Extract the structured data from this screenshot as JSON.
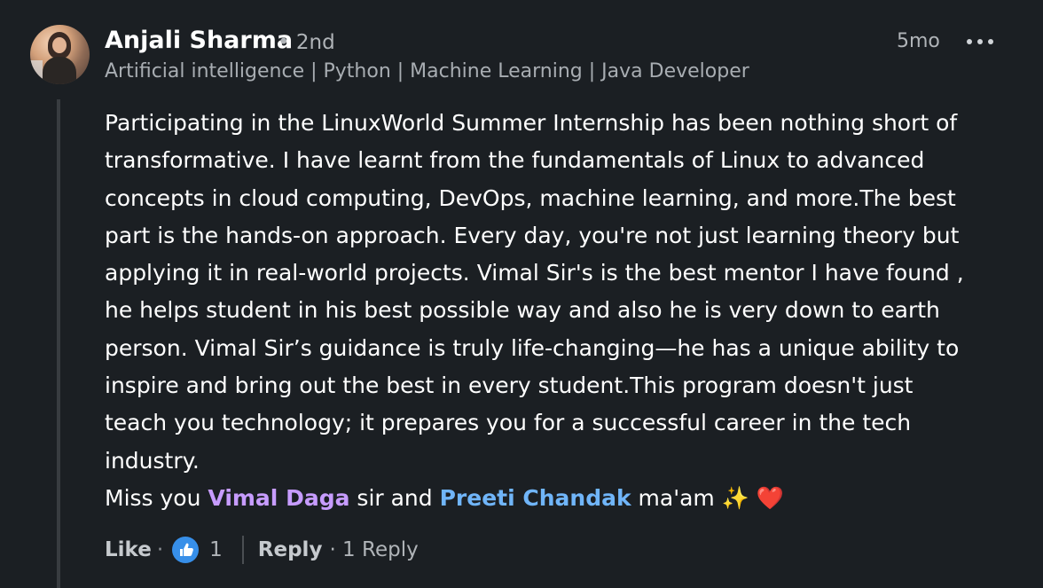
{
  "author": {
    "name": "Anjali Sharma",
    "degree": "• 2nd",
    "headline": "Artificial intelligence | Python | Machine Learning | Java Developer"
  },
  "timestamp": "5mo",
  "more_icon": "more-horizontal-icon",
  "comment": {
    "lines": [
      "Participating in the LinuxWorld Summer Internship has been nothing short of",
      "transformative. I have learnt from the fundamentals of Linux to advanced",
      "concepts in cloud computing, DevOps, machine learning, and more.The best",
      "part is the hands-on approach. Every day, you're not just learning theory but",
      "applying it in real-world projects. Vimal Sir's is the best mentor I have found ,",
      "he helps student in his best possible way and also he is very down to earth",
      "person. Vimal Sir’s guidance is truly life-changing—he has a unique ability to",
      "inspire and bring out the best in every student.This program doesn't just",
      "teach you technology; it prepares you for a successful career in the tech",
      "industry."
    ],
    "closing": {
      "prefix": "Miss you ",
      "mention1": "Vimal Daga",
      "middle": " sir and ",
      "mention2": "Preeti Chandak",
      "suffix": " ma'am ",
      "emoji": "✨ ❤️"
    },
    "mention_colors": {
      "purple": "#c79cff",
      "blue": "#70b5f9"
    }
  },
  "actions": {
    "like_label": "Like",
    "dot": "·",
    "like_icon": "thumbs-up-icon",
    "like_count": "1",
    "reply_label": "Reply",
    "reply_count": "· 1 Reply"
  },
  "colors": {
    "background": "#1b1f23",
    "like_icon_bg": "#378fe9"
  }
}
